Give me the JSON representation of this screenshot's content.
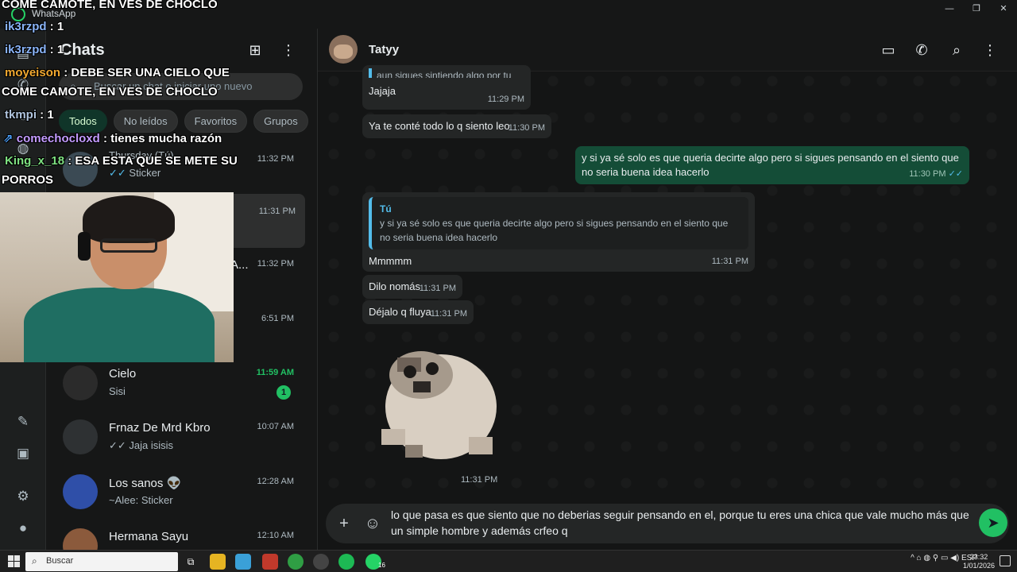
{
  "window": {
    "app_name": "WhatsApp",
    "min": "—",
    "max": "❐",
    "close": "✕"
  },
  "chat_list": {
    "title": "Chats",
    "search_placeholder": "Buscar un chat o iniciar uno nuevo",
    "filters": [
      "Todos",
      "No leídos",
      "Favoritos",
      "Grupos"
    ],
    "rail_badge": "16",
    "rows": [
      {
        "name": "",
        "preview": "Thursday (Tú)",
        "preview2": "Sticker",
        "time": "11:32 PM"
      },
      {
        "name": "",
        "preview": "",
        "time": "11:31 PM"
      },
      {
        "name": "A...",
        "preview": "",
        "time": "11:32 PM"
      },
      {
        "name": "",
        "preview": "",
        "time": "6:51 PM"
      },
      {
        "name": "Cielo",
        "preview": "Sisi",
        "time": "11:59 AM",
        "badge": "1"
      },
      {
        "name": "Frnaz De Mrd Kbro",
        "preview": "Jaja isisis",
        "time": "10:07 AM"
      },
      {
        "name": "Los sanos 👽",
        "preview": "~Alee: Sticker",
        "time": "12:28 AM"
      },
      {
        "name": "Hermana Sayu",
        "preview": "",
        "time": "12:10 AM"
      }
    ]
  },
  "conversation": {
    "contact_name": "Tatyy",
    "messages": [
      {
        "dir": "in",
        "text": "aun sigues sintiendo algo por tu ex?",
        "time": ""
      },
      {
        "dir": "in",
        "text": "Jajaja",
        "time": "11:29 PM"
      },
      {
        "dir": "in",
        "text": "Ya te conté todo lo q siento leo",
        "time": "11:30 PM"
      },
      {
        "dir": "out",
        "text": "y si ya sé solo es que queria decirte algo pero si sigues pensando en el siento que no seria buena idea hacerlo",
        "time": "11:30 PM"
      },
      {
        "dir": "in",
        "quote_name": "Tú",
        "quote_text": "y si ya sé solo es que queria decirte algo pero si sigues pensando en el siento que no seria buena idea hacerlo",
        "text": "Mmmmm",
        "time": "11:31 PM"
      },
      {
        "dir": "in",
        "text": "Dilo nomás",
        "time": "11:31 PM"
      },
      {
        "dir": "in",
        "text": "Déjalo q fluya",
        "time": "11:31 PM"
      },
      {
        "dir": "in",
        "type": "sticker",
        "time": "11:31 PM"
      }
    ],
    "composer_text": "lo que pasa es que siento que no deberias seguir pensando en el, porque tu eres una chica que vale mucho más que un simple hombre y además crfeo q"
  },
  "stream_overlay": [
    {
      "user": "",
      "text": "COME CAMOTE, EN VES DE CHOCLO",
      "user_color": "#ffffff"
    },
    {
      "user": "ik3rzpd",
      "text": " : 1",
      "user_color": "#8ab4f8"
    },
    {
      "user": "ik3rzpd",
      "text": " : 1",
      "user_color": "#8ab4f8"
    },
    {
      "user": "moyeison",
      "text": " : DEBE SER UNA CIELO QUE",
      "user_color": "#f0a830"
    },
    {
      "user": "",
      "text": "COME CAMOTE, EN VES DE CHOCLO",
      "user_color": "#ffffff"
    },
    {
      "user": "tkmpi",
      "text": " : 1",
      "user_color": "#b0c4de"
    },
    {
      "user": "comechocloxd",
      "text": " : tienes mucha razón",
      "user_color": "#c39bff"
    },
    {
      "user": "King_x_18",
      "text": " : ESA ESTA QUE SE METE SU",
      "user_color": "#7ee081"
    },
    {
      "user": "",
      "text": "PORROS",
      "user_color": "#ffffff"
    }
  ],
  "taskbar": {
    "search_placeholder": "Buscar",
    "lang": "ESP",
    "time": "23:32",
    "date": "1/01/2026",
    "wa_badge": "16"
  },
  "colors": {
    "accent_green": "#21c063",
    "outgoing_bubble": "#144d37",
    "incoming_bubble": "#242626",
    "quote_bar": "#53bdeb"
  }
}
